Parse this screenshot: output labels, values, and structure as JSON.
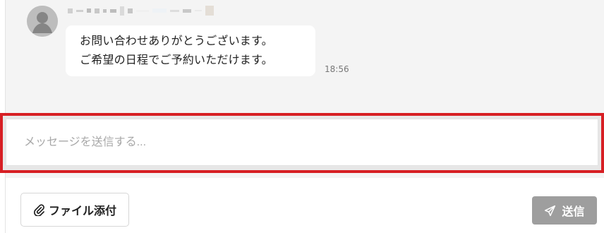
{
  "message": {
    "lines": [
      "お問い合わせありがとうございます。",
      "ご希望の日程でご予約いただけます。"
    ],
    "time": "18:56"
  },
  "composer": {
    "placeholder": "メッセージを送信する..."
  },
  "actions": {
    "file_attach_label": "ファイル添付",
    "send_label": "送信"
  },
  "icons": {
    "avatar": "user-avatar-icon",
    "attach": "paperclip-icon",
    "send": "paper-plane-icon"
  },
  "colors": {
    "highlight": "#d71f24",
    "send_button": "#9e9e9e",
    "chat_background": "#f4f4f4"
  }
}
